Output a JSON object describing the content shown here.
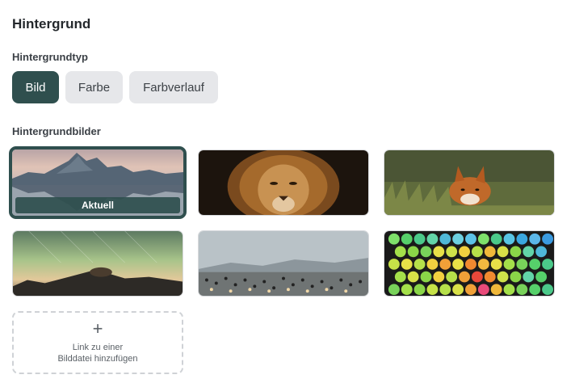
{
  "section_title": "Hintergrund",
  "background_type": {
    "label": "Hintergrundtyp",
    "options": [
      "Bild",
      "Farbe",
      "Farbverlauf"
    ],
    "selected": "Bild"
  },
  "background_images": {
    "label": "Hintergrundbilder",
    "current_badge": "Aktuell",
    "add_link_line1": "Link zu einer",
    "add_link_line2": "Bilddatei hinzufügen"
  },
  "colors": {
    "accent": "#2f4f4e",
    "inactive_button": "#e6e7ea"
  }
}
